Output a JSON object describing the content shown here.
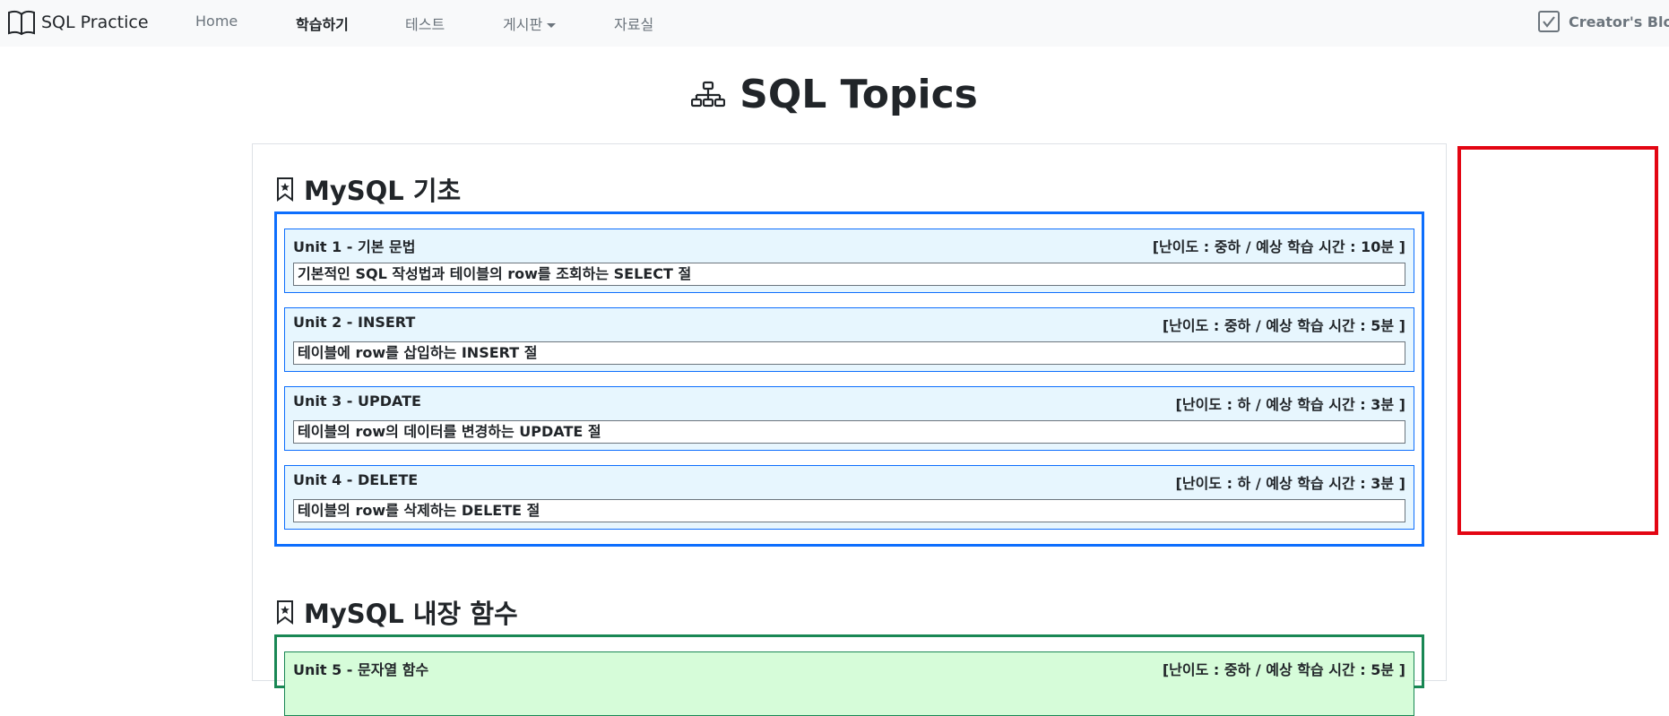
{
  "navbar": {
    "brand": "SQL Practice",
    "items": [
      {
        "label": "Home"
      },
      {
        "label": "학습하기"
      },
      {
        "label": "테스트"
      },
      {
        "label": "게시판"
      },
      {
        "label": "자료실"
      }
    ],
    "blog_link": "Creator's Blog"
  },
  "page_title": "SQL Topics",
  "sections": [
    {
      "heading": "MySQL 기초",
      "units": [
        {
          "title": "Unit 1 - 기본 문법",
          "meta": "[난이도 : 중하 / 예상 학습 시간 : 10분 ]",
          "desc": "기본적인 SQL 작성법과 테이블의 row를 조회하는 SELECT 절"
        },
        {
          "title": "Unit 2 - INSERT",
          "meta": "[난이도 : 중하 / 예상 학습 시간 : 5분 ]",
          "desc": "테이블에 row를 삽입하는 INSERT 절"
        },
        {
          "title": "Unit 3 - UPDATE",
          "meta": "[난이도 : 하 / 예상 학습 시간 : 3분 ]",
          "desc": "테이블의 row의 데이터를 변경하는 UPDATE 절"
        },
        {
          "title": "Unit 4 - DELETE",
          "meta": "[난이도 : 하 / 예상 학습 시간 : 3분 ]",
          "desc": "테이블의 row를 삭제하는 DELETE 절"
        }
      ]
    },
    {
      "heading": "MySQL 내장 함수",
      "units": [
        {
          "title": "Unit 5 - 문자열 함수",
          "meta": "[난이도 : 중하 / 예상 학습 시간 : 5분 ]"
        }
      ]
    }
  ],
  "colors": {
    "section1_border": "#0d6efd",
    "section1_unit_bg": "#e7f6fe",
    "section2_border": "#198754",
    "section2_unit_bg": "#d6fcd9",
    "ad_border": "#e30613"
  }
}
